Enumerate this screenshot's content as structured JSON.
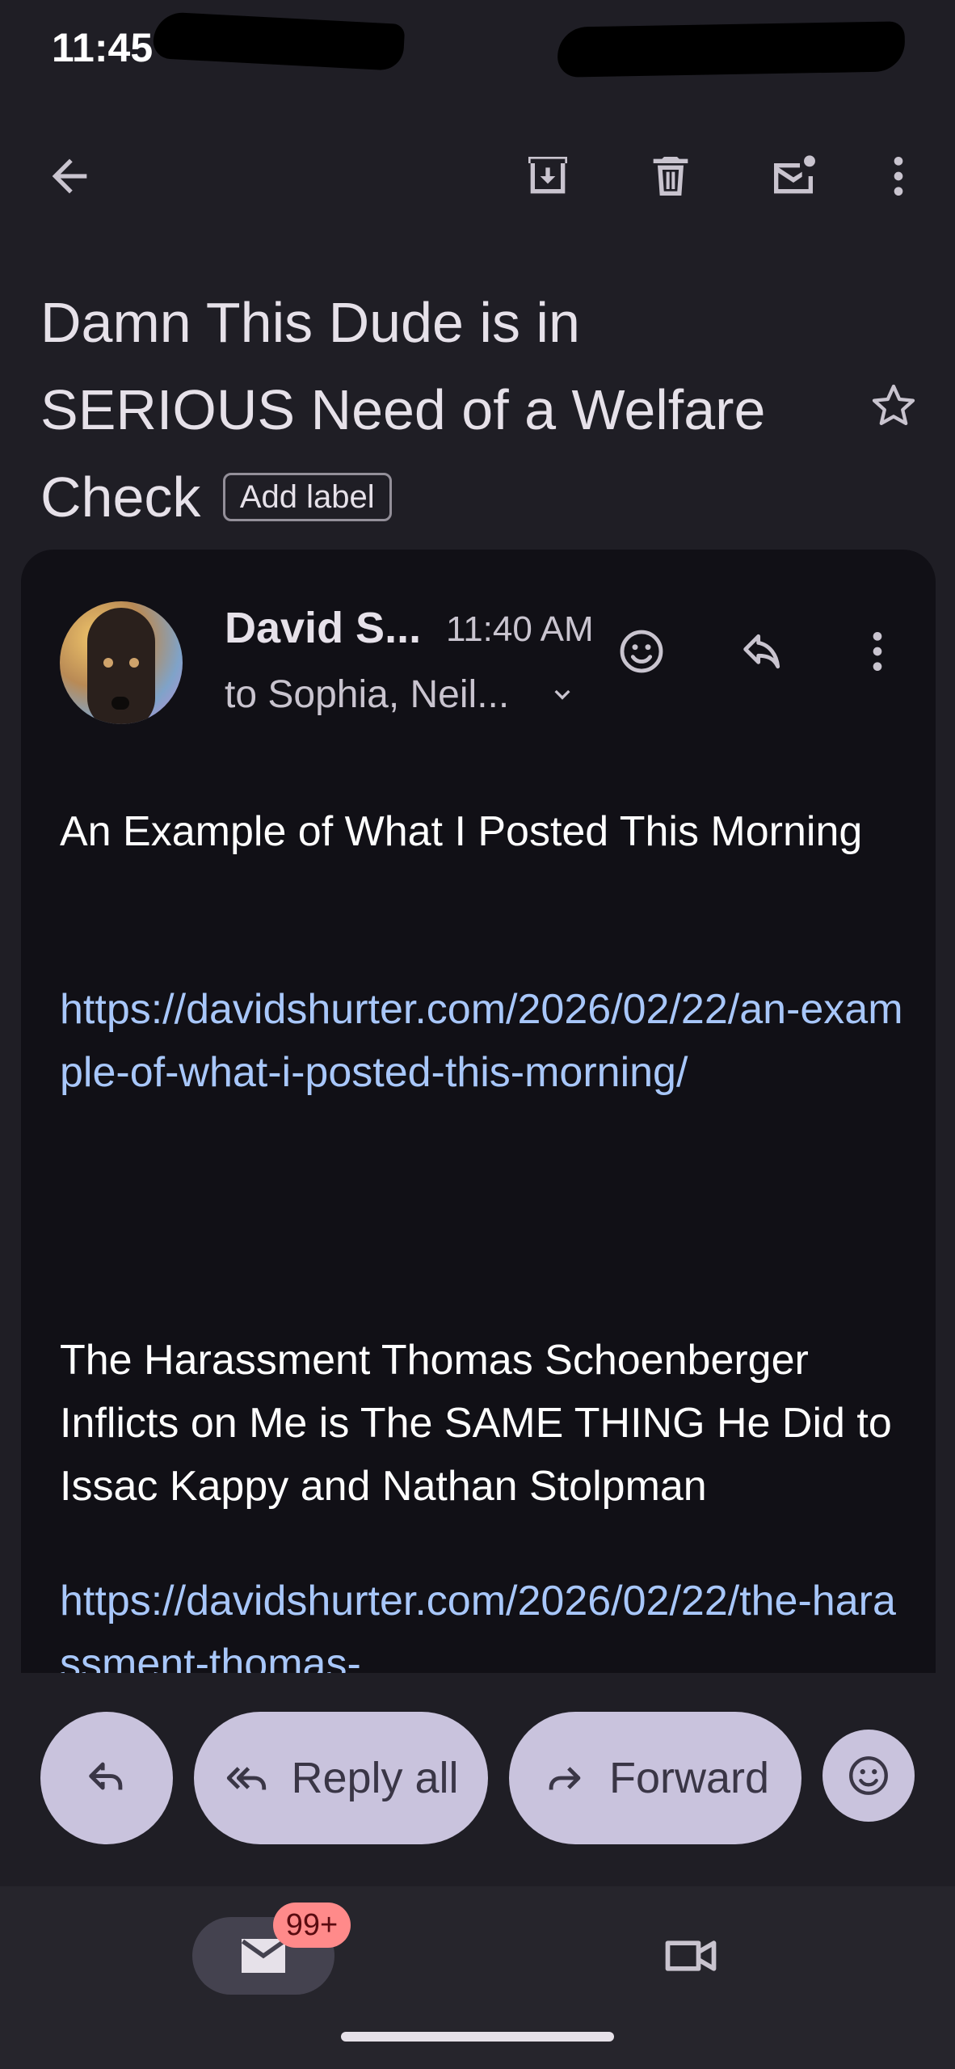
{
  "status_bar": {
    "time": "11:45"
  },
  "toolbar": {
    "back_icon": "arrow-back-icon",
    "archive_icon": "archive-icon",
    "delete_icon": "trash-icon",
    "mark_unread_icon": "mail-unread-icon",
    "more_icon": "more-vert-icon"
  },
  "email": {
    "subject": "Damn This Dude is in SERIOUS Need of a Welfare Check",
    "add_label": "Add label",
    "star_icon": "star-outline-icon",
    "message": {
      "sender": "David S...",
      "time": "11:40 AM",
      "recipients": "to Sophia, Neil...",
      "body": [
        {
          "type": "text",
          "value": "An Example of What I Posted This Morning"
        },
        {
          "type": "link",
          "value": "https://davidshurter.com/2026/02/22/an-example-of-what-i-posted-this-morning/"
        },
        {
          "type": "text",
          "value": "The Harassment Thomas Schoenberger Inflicts on Me is The SAME THING He Did to Issac Kappy and Nathan Stolpman"
        },
        {
          "type": "link",
          "value": "https://davidshurter.com/2026/02/22/the-harassment-thomas-"
        }
      ]
    }
  },
  "actions": {
    "reply_all": "Reply all",
    "forward": "Forward"
  },
  "nav": {
    "mail_badge": "99+"
  },
  "colors": {
    "background": "#1f1e25",
    "card": "#111016",
    "link": "#a8c7fa",
    "pill": "#c9c3dd",
    "badge": "#ff8a8a"
  }
}
